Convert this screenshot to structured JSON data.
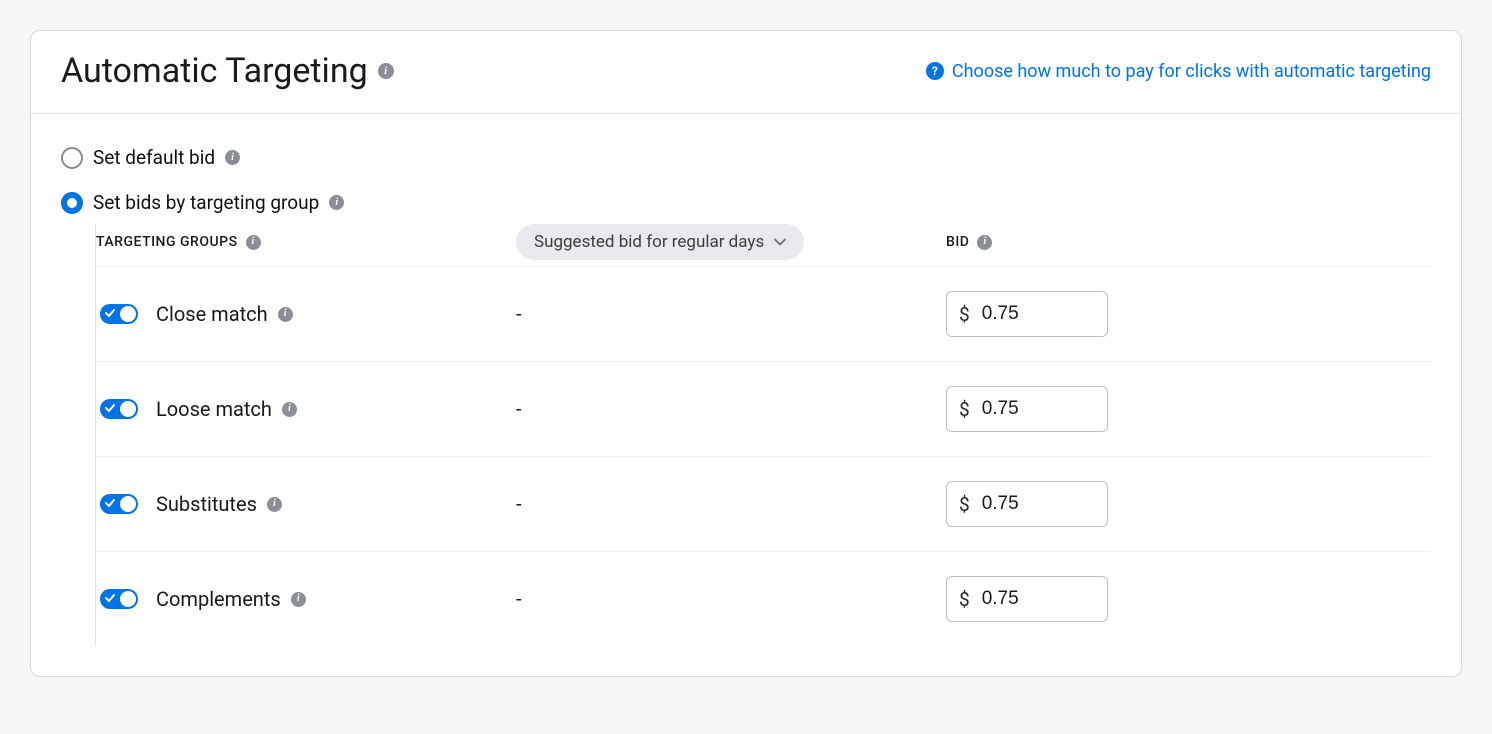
{
  "header": {
    "title": "Automatic Targeting",
    "help_text": "Choose how much to pay for clicks with automatic targeting"
  },
  "bid_mode": {
    "default_label": "Set default bid",
    "group_label": "Set bids by targeting group",
    "selected": "group"
  },
  "columns": {
    "groups_label": "TARGETING GROUPS",
    "suggested_label": "Suggested bid for regular days",
    "bid_label": "BID"
  },
  "currency": "$",
  "groups": [
    {
      "name": "Close match",
      "on": true,
      "suggested": "-",
      "bid": "0.75"
    },
    {
      "name": "Loose match",
      "on": true,
      "suggested": "-",
      "bid": "0.75"
    },
    {
      "name": "Substitutes",
      "on": true,
      "suggested": "-",
      "bid": "0.75"
    },
    {
      "name": "Complements",
      "on": true,
      "suggested": "-",
      "bid": "0.75"
    }
  ]
}
